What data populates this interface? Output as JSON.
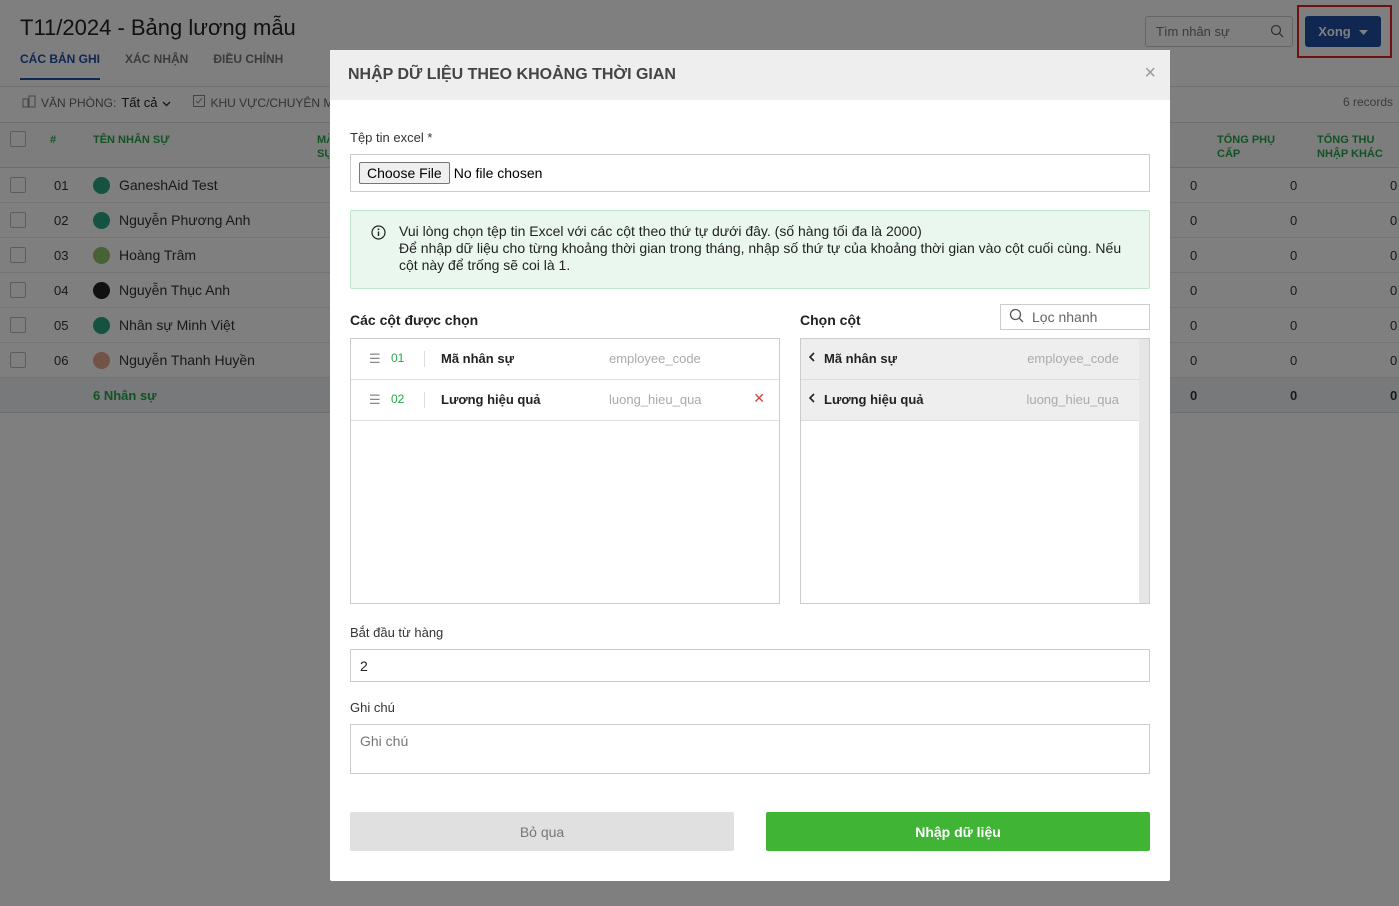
{
  "page": {
    "title": "T11/2024 - Bảng lương mẫu",
    "tabs": [
      "CÁC BẢN GHI",
      "XÁC NHẬN",
      "ĐIỀU CHỈNH"
    ],
    "search_placeholder": "Tìm nhân sự",
    "done_label": "Xong",
    "filters": {
      "office_label": "VĂN PHÒNG:",
      "office_value": "Tất cả",
      "region_label": "KHU VỰC/CHUYÊN MÔN"
    },
    "records": "6 records",
    "columns": {
      "num": "#",
      "name": "TÊN NHÂN SỰ",
      "code_part": "MÃ SỰ",
      "allowance": "TỔNG PHỤ CẤP",
      "other_income": "TỔNG THU NHẬP KHÁC"
    },
    "rows": [
      {
        "num": "01",
        "name": "GaneshAid Test",
        "v1": "0",
        "v2": "0",
        "v3": "0"
      },
      {
        "num": "02",
        "name": "Nguyễn Phương Anh",
        "v1": "0",
        "v2": "0",
        "v3": "0"
      },
      {
        "num": "03",
        "name": "Hoàng Trâm",
        "v1": "0",
        "v2": "0",
        "v3": "0"
      },
      {
        "num": "04",
        "name": "Nguyễn Thục Anh",
        "v1": "0",
        "v2": "0",
        "v3": "0"
      },
      {
        "num": "05",
        "name": "Nhân sự Minh Việt",
        "v1": "0",
        "v2": "0",
        "v3": "0"
      },
      {
        "num": "06",
        "name": "Nguyễn Thanh Huyền",
        "v1": "0",
        "v2": "0",
        "v3": "0"
      }
    ],
    "summary": {
      "count": "6 Nhân sự",
      "v1": "0",
      "v2": "0",
      "v3": "0"
    }
  },
  "modal": {
    "title": "NHẬP DỮ LIỆU THEO KHOẢNG THỜI GIAN",
    "close": "×",
    "file_label": "Tệp tin excel *",
    "file_button": "Choose File",
    "file_status": "No file chosen",
    "info_line1": "Vui lòng chọn tệp tin Excel với các cột theo thứ tự dưới đây. (số hàng tối đa là 2000)",
    "info_line2": "Để nhập dữ liệu cho từng khoảng thời gian trong tháng, nhập số thứ tự của khoảng thời gian vào cột cuối cùng. Nếu cột này để trống sẽ coi là 1.",
    "selected_title": "Các cột được chọn",
    "choose_title": "Chọn cột",
    "quick_filter_placeholder": "Lọc nhanh",
    "selected_columns": [
      {
        "idx": "01",
        "name": "Mã nhân sự",
        "code": "employee_code"
      },
      {
        "idx": "02",
        "name": "Lương hiệu quả",
        "code": "luong_hieu_qua"
      }
    ],
    "available_columns": [
      {
        "name": "Mã nhân sự",
        "code": "employee_code"
      },
      {
        "name": "Lương hiệu quả",
        "code": "luong_hieu_qua"
      }
    ],
    "start_row_label": "Bắt đầu từ hàng",
    "start_row_value": "2",
    "note_label": "Ghi chú",
    "note_placeholder": "Ghi chú",
    "cancel_label": "Bỏ qua",
    "import_label": "Nhập dữ liệu"
  },
  "colors": {
    "accent": "#1e4fa3",
    "green": "#27a54a",
    "import_button": "#3fb435",
    "highlight": "#e02020"
  }
}
